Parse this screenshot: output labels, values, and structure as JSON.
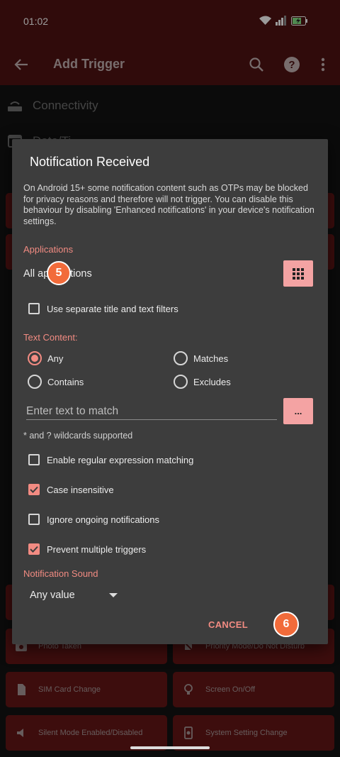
{
  "status": {
    "time": "01:02"
  },
  "appbar": {
    "title": "Add Trigger"
  },
  "background_list": [
    {
      "label": "Connectivity",
      "icon": "router-icon"
    },
    {
      "label": "Date/Ti...",
      "icon": "calendar-icon"
    }
  ],
  "tiles": [
    {
      "label": "Photo Taken",
      "icon": "camera-icon"
    },
    {
      "label": "Priority Mode/Do Not Disturb",
      "icon": "bell-off-icon"
    },
    {
      "label": "SIM Card Change",
      "icon": "sim-card-icon"
    },
    {
      "label": "Screen On/Off",
      "icon": "lightbulb-icon"
    },
    {
      "label": "Silent Mode Enabled/Disabled",
      "icon": "speaker-icon"
    },
    {
      "label": "System Setting Change",
      "icon": "settings-phone-icon"
    }
  ],
  "dialog": {
    "title": "Notification Received",
    "body": "On Android 15+ some notification content such as OTPs may be blocked for privacy reasons and therefore will not trigger. You can disable this behaviour by disabling 'Enhanced notifications' in your device's notification settings.",
    "applications_header": "Applications",
    "applications_value": "All applications",
    "separate_filters_label": "Use separate title and text filters",
    "text_content_header": "Text Content:",
    "radio_options": {
      "any": "Any",
      "matches": "Matches",
      "contains": "Contains",
      "excludes": "Excludes"
    },
    "text_input_placeholder": "Enter text to match",
    "ellipsis_label": "...",
    "wildcard_hint": "* and ? wildcards supported",
    "checkboxes": {
      "regex": "Enable regular expression matching",
      "case": "Case insensitive",
      "ongoing": "Ignore ongoing notifications",
      "prevent": "Prevent multiple triggers"
    },
    "sound_header": "Notification Sound",
    "sound_value": "Any value",
    "cancel_label": "CANCEL"
  },
  "badges": {
    "five": "5",
    "six": "6"
  },
  "colors": {
    "accent": "#f28b82",
    "appbar": "#4a1212",
    "tile": "#5e1515",
    "dialog": "#3d3d3d",
    "badge": "#f26b3a"
  }
}
